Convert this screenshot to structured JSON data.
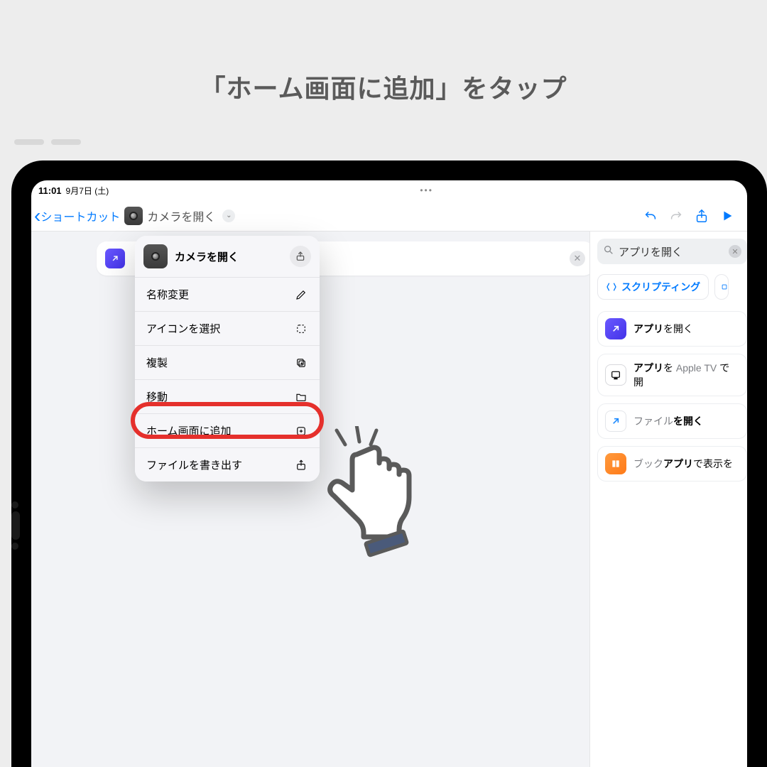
{
  "instruction": "「ホーム画面に追加」をタップ",
  "status": {
    "time": "11:01",
    "date": "9月7日 (土)"
  },
  "toolbar": {
    "back_label": "ショートカット",
    "shortcut_name": "カメラを開く"
  },
  "popup": {
    "title": "カメラを開く",
    "items": [
      {
        "label": "名称変更",
        "icon": "pencil"
      },
      {
        "label": "アイコンを選択",
        "icon": "selection"
      },
      {
        "label": "複製",
        "icon": "duplicate"
      },
      {
        "label": "移動",
        "icon": "folder"
      },
      {
        "label": "ホーム画面に追加",
        "icon": "add-square"
      },
      {
        "label": "ファイルを書き出す",
        "icon": "export"
      }
    ]
  },
  "search": {
    "query": "アプリを開く"
  },
  "chip_label": "スクリプティング",
  "actions": {
    "open_app": {
      "b1": "アプリ",
      "t": "を開く"
    },
    "appletv": {
      "b1": "アプリ",
      "t": "を ",
      "g": "Apple TV",
      "t2": " で開"
    },
    "open_file": {
      "g": "ファイル",
      "b1": "を開く"
    },
    "books": {
      "g": "ブック",
      "b1": "アプリ",
      "t": "で表示を"
    }
  }
}
